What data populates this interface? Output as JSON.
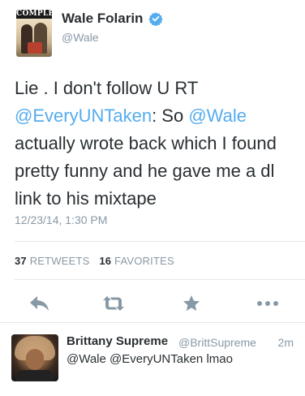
{
  "tweet": {
    "display_name": "Wale Folarin",
    "handle": "@Wale",
    "avatar_label": "COMPLEX",
    "text_parts": {
      "p1": "Lie . I don't follow U RT ",
      "m1": "@EveryUNTaken",
      "p2": ": So ",
      "m2": "@Wale",
      "p3": " actually wrote back which I found pretty funny and he gave me a dl link to his mixtape"
    },
    "timestamp": "12/23/14, 1:30 PM",
    "retweets_count": "37",
    "retweets_label": "RETWEETS",
    "favorites_count": "16",
    "favorites_label": "FAVORITES"
  },
  "actions": {
    "reply_icon": "reply-icon",
    "retweet_icon": "retweet-icon",
    "favorite_icon": "star-icon",
    "more_icon": "more-dots-icon"
  },
  "reply": {
    "display_name": "Brittany Supreme",
    "handle": "@BrittSupreme",
    "time": "2m",
    "text": "@Wale @EveryUNTaken lmao"
  },
  "colors": {
    "accent": "#55acee",
    "text": "#292f33",
    "muted": "#8899a6",
    "divider": "#e1e8ed"
  }
}
